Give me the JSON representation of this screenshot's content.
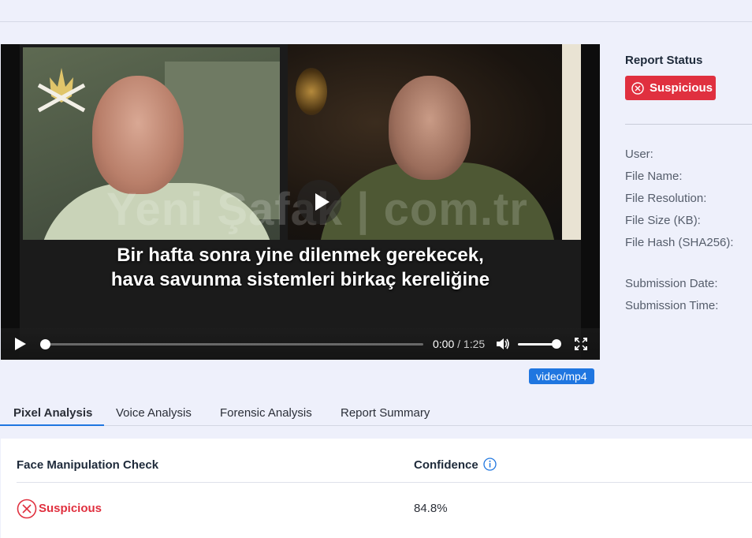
{
  "video": {
    "subtitle_line1": "Bir hafta sonra yine dilenmek gerekecek,",
    "subtitle_line2": "hava savunma sistemleri birkaç kereliğine",
    "watermark": "Yeni Şafak | com.tr",
    "current_time": "0:00",
    "time_separator": "/",
    "duration": "1:25",
    "progress": 0,
    "volume": 0.9,
    "mime_type": "video/mp4"
  },
  "report": {
    "title": "Report Status",
    "status": "Suspicious",
    "status_color": "#e0303f",
    "fields": {
      "user": "User:",
      "file_name": "File Name:",
      "file_resolution": "File Resolution:",
      "file_size": "File Size (KB):",
      "file_hash": "File Hash (SHA256):",
      "submission_date": "Submission Date:",
      "submission_time": "Submission Time:"
    }
  },
  "tabs": [
    {
      "label": "Pixel Analysis",
      "active": true
    },
    {
      "label": "Voice Analysis",
      "active": false
    },
    {
      "label": "Forensic Analysis",
      "active": false
    },
    {
      "label": "Report Summary",
      "active": false
    }
  ],
  "analysis": {
    "check_header": "Face Manipulation Check",
    "confidence_header": "Confidence",
    "result_label": "Suspicious",
    "confidence_value": "84.8%"
  },
  "colors": {
    "accent": "#1f76e0",
    "danger": "#e0303f",
    "background": "#eef0fb"
  }
}
